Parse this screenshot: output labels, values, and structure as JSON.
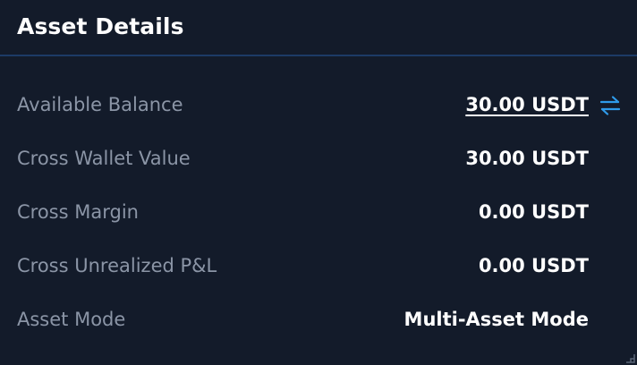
{
  "panel": {
    "title": "Asset Details"
  },
  "colors": {
    "background": "#131b2a",
    "divider": "#1d3b66",
    "label": "#8b95a6",
    "value": "#ffffff",
    "accent": "#2f9bea"
  },
  "rows": [
    {
      "label": "Available Balance",
      "value": "30.00 USDT"
    },
    {
      "label": "Cross Wallet Value",
      "value": "30.00 USDT"
    },
    {
      "label": "Cross Margin",
      "value": "0.00 USDT"
    },
    {
      "label": "Cross Unrealized P&L",
      "value": "0.00 USDT"
    },
    {
      "label": "Asset Mode",
      "value": "Multi-Asset Mode"
    }
  ],
  "icons": {
    "transfer": "transfer-arrows-icon",
    "resize": "resize-handle-icon"
  }
}
